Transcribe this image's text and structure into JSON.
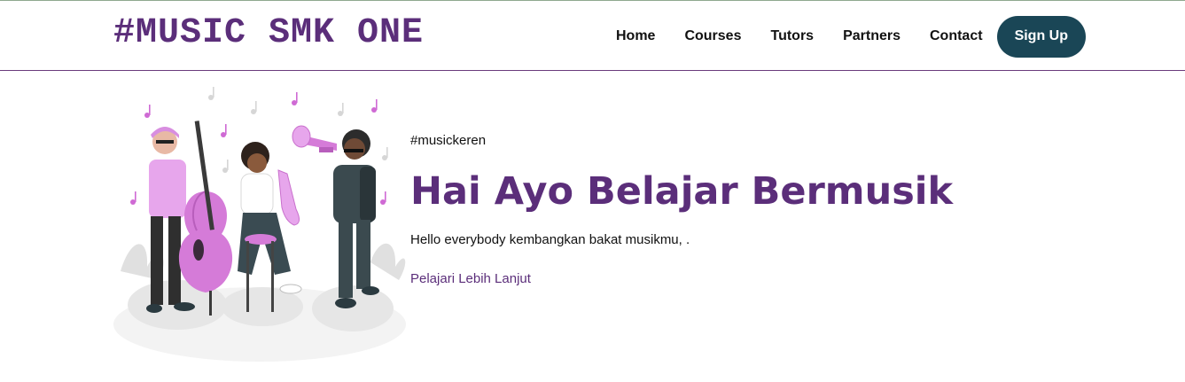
{
  "header": {
    "brand": "#MUSIC SMK ONE",
    "nav": [
      {
        "label": "Home"
      },
      {
        "label": "Courses"
      },
      {
        "label": "Tutors"
      },
      {
        "label": "Partners"
      },
      {
        "label": "Contact"
      }
    ],
    "signup_label": "Sign Up"
  },
  "hero": {
    "tagline": "#musickeren",
    "title": "Hai Ayo Belajar Bermusik",
    "description": "Hello everybody kembangkan bakat musikmu, .",
    "link_label": "Pelajari Lebih Lanjut",
    "illustration_icon": "music-band-illustration"
  },
  "colors": {
    "brand_purple": "#5b2e7a",
    "signup_bg": "#1a4656",
    "accent_pink": "#d57bd8"
  }
}
